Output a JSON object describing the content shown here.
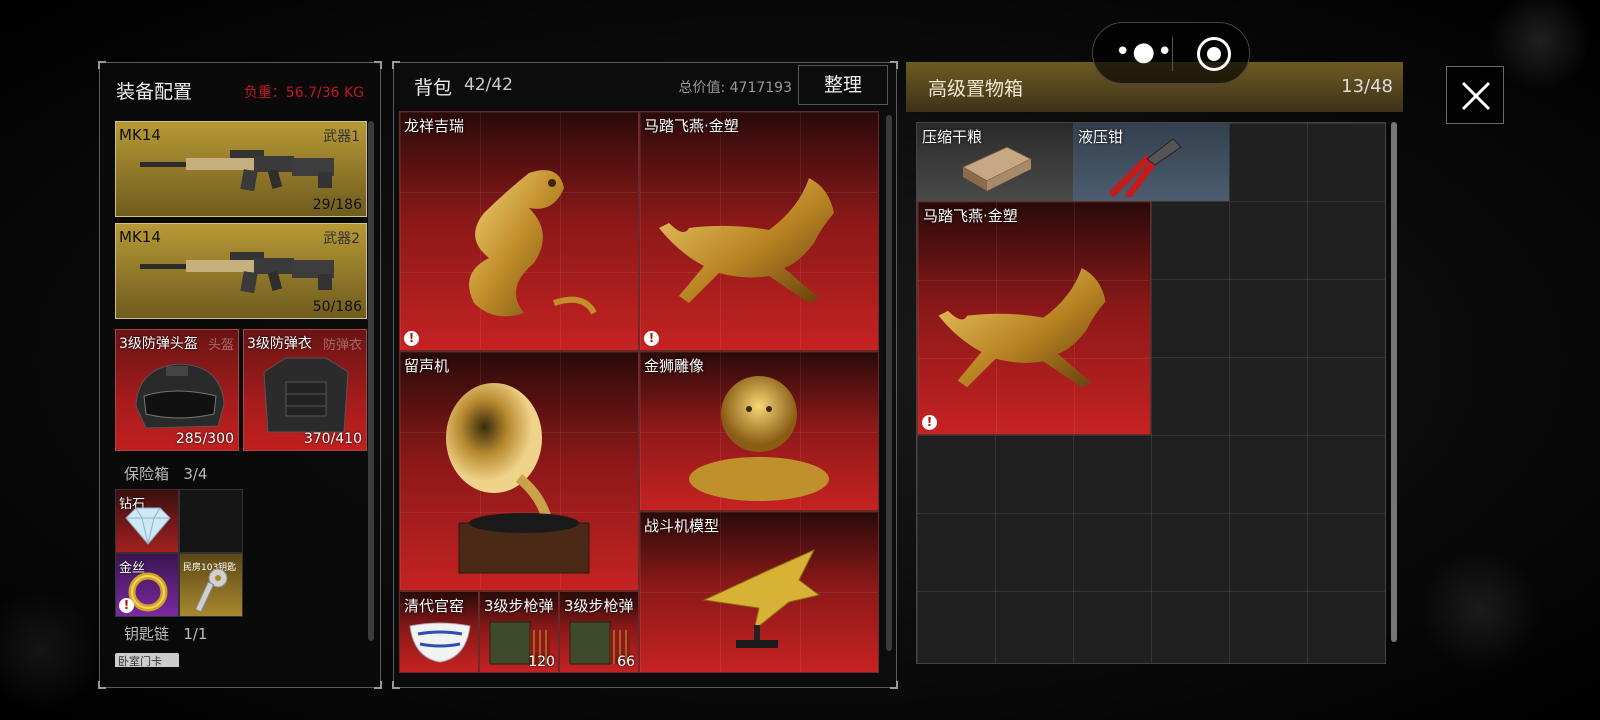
{
  "equipment": {
    "title": "装备配置",
    "weight": "负重：56.7/36 KG",
    "weapons": [
      {
        "name": "MK14",
        "slot": "武器1",
        "ammo": "29/186"
      },
      {
        "name": "MK14",
        "slot": "武器2",
        "ammo": "50/186"
      }
    ],
    "armor": [
      {
        "name": "3级防弹头盔",
        "ghost": "头盔",
        "durability": "285/300"
      },
      {
        "name": "3级防弹衣",
        "ghost": "防弹衣",
        "durability": "370/410"
      }
    ],
    "safe_box": {
      "label": "保险箱",
      "count": "3/4",
      "items": [
        {
          "name": "钻石"
        },
        {
          "name": "金丝"
        },
        {
          "name": "民房103钥匙"
        }
      ]
    },
    "keychain": {
      "label": "钥匙链",
      "count": "1/1",
      "item": "卧室门卡"
    }
  },
  "backpack": {
    "title": "背包",
    "count": "42/42",
    "total_value": "总价值: 4717193",
    "sort_label": "整理",
    "items": [
      {
        "name": "龙祥吉瑞"
      },
      {
        "name": "马踏飞燕·金塑"
      },
      {
        "name": "留声机"
      },
      {
        "name": "金狮雕像"
      },
      {
        "name": "战斗机模型"
      },
      {
        "name": "清代官窑"
      },
      {
        "name": "3级步枪弹",
        "qty": "120"
      },
      {
        "name": "3级步枪弹",
        "qty": "66"
      }
    ]
  },
  "storage": {
    "title": "高级置物箱",
    "count": "13/48",
    "items": [
      {
        "name": "压缩干粮"
      },
      {
        "name": "液压钳"
      },
      {
        "name": "马踏飞燕·金塑"
      }
    ]
  },
  "colors": {
    "rarity_red": "#c62222",
    "rarity_gold": "#b79934",
    "rarity_purple": "#6a1e8a",
    "rarity_blue": "#3a4a5e",
    "weight_warning": "#c4161c"
  },
  "icons": [
    "more-dots-icon",
    "target-icon",
    "close-icon",
    "warning-icon"
  ]
}
